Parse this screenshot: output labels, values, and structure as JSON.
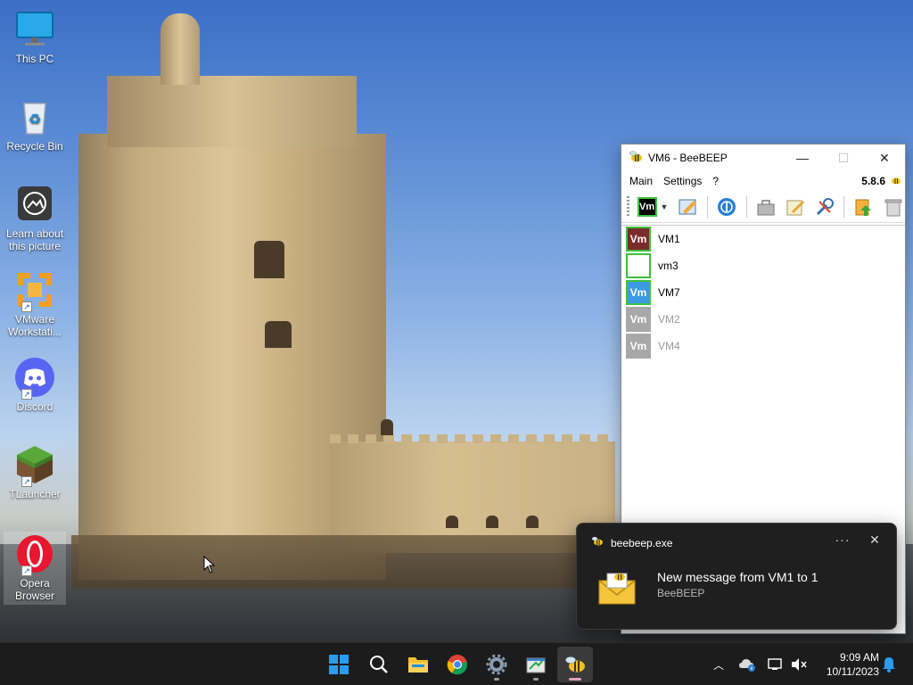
{
  "desktop": {
    "icons": [
      {
        "label": "This PC",
        "icon": "monitor-icon"
      },
      {
        "label": "Recycle Bin",
        "icon": "recycle-bin-icon"
      },
      {
        "label": "Learn about this picture",
        "icon": "camera-icon"
      },
      {
        "label": "VMware Workstati...",
        "icon": "vmware-icon"
      },
      {
        "label": "Discord",
        "icon": "discord-icon"
      },
      {
        "label": "TLauncher",
        "icon": "grass-block-icon"
      },
      {
        "label": "Opera Browser",
        "icon": "opera-icon"
      }
    ]
  },
  "beebeep": {
    "title": "VM6 - BeeBEEP",
    "menu": [
      "Main",
      "Settings",
      "?"
    ],
    "version": "5.8.6",
    "status_avatar": "Vm",
    "users": [
      {
        "avatar": "Vm",
        "name": "VM1",
        "status": "online",
        "color": "#7a2b2b"
      },
      {
        "avatar": "",
        "name": "vm3",
        "status": "online",
        "color": "#ffffff"
      },
      {
        "avatar": "Vm",
        "name": "VM7",
        "status": "online",
        "color": "#3b9be0"
      },
      {
        "avatar": "Vm",
        "name": "VM2",
        "status": "offline",
        "color": "#a8a8a8"
      },
      {
        "avatar": "Vm",
        "name": "VM4",
        "status": "offline",
        "color": "#a8a8a8"
      }
    ]
  },
  "notification": {
    "app": "beebeep.exe",
    "more": "···",
    "close": "✕",
    "title": "New message from VM1 to 1",
    "body": "BeeBEEP"
  },
  "taskbar": {
    "apps": [
      "start-icon",
      "search-icon",
      "file-explorer-icon",
      "chrome-icon",
      "settings-icon",
      "winscp-icon",
      "beebeep-icon"
    ],
    "time": "9:09 AM",
    "date": "10/11/2023"
  },
  "colors": {
    "taskbar_bg": "#1c1c1c",
    "toast_bg": "#1f1f1f",
    "online_border": "#3cc23c"
  }
}
